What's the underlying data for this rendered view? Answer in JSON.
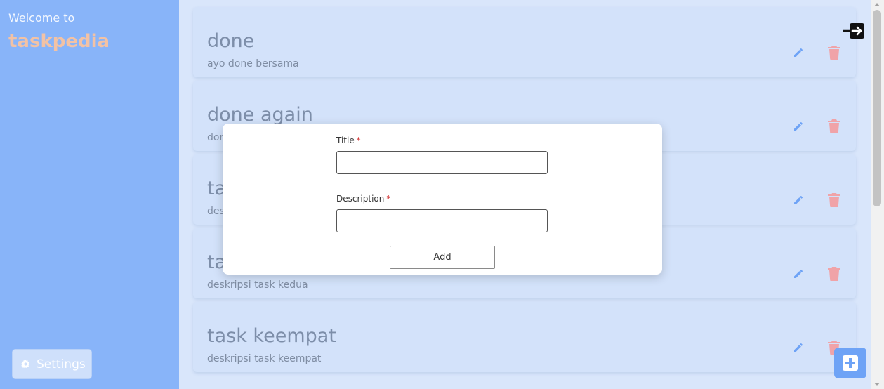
{
  "sidebar": {
    "welcome": "Welcome to",
    "brand": "taskpedia",
    "settings_label": "Settings",
    "settings_icon": "gear-icon"
  },
  "tasks": [
    {
      "title": "done",
      "description": "ayo done bersama"
    },
    {
      "title": "done again",
      "description": "dor"
    },
    {
      "title": "ta",
      "description": "des"
    },
    {
      "title": "ta",
      "description": "deskripsi task kedua"
    },
    {
      "title": "task keempat",
      "description": "deskripsi task keempat"
    }
  ],
  "modal": {
    "title_label": "Title",
    "description_label": "Description",
    "required_mark": "*",
    "title_value": "",
    "description_value": "",
    "add_label": "Add"
  },
  "colors": {
    "sidebar_bg": "#88b4f9",
    "brand": "#f2c2a5",
    "main_bg": "#d9e6fb",
    "card_bg": "#d3e2fa",
    "edit_icon": "#6ea3f6",
    "delete_icon": "#f0a3a8",
    "fab": "#6ea3f6"
  },
  "icons": {
    "edit": "pencil-icon",
    "delete": "trash-icon",
    "logout": "logout-icon",
    "add": "plus-square-icon"
  }
}
